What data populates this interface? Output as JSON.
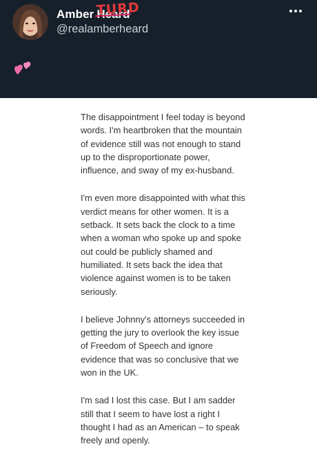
{
  "profile": {
    "display_name": "Amber",
    "struck_name": "Heard",
    "scribble": "TURD",
    "handle": "@realamberheard",
    "bio_icon": "two-hearts-emoji",
    "accent": "#e0245e"
  },
  "header": {
    "menu_icon": "more-dots-icon"
  },
  "statement": {
    "paragraphs": [
      "The disappointment I feel today is beyond words. I'm heartbroken that the mountain of evidence still was not enough to stand up to the disproportionate power, influence, and sway of my ex-husband.",
      "I'm even more disappointed with what this verdict means for other women. It is a setback. It sets back the clock to a time when a woman who spoke up and spoke out could be publicly shamed and humiliated. It sets back the idea that violence against women is to be taken seriously.",
      "I believe Johnny's attorneys succeeded in getting the jury to overlook the key issue of Freedom of Speech and ignore evidence that was so conclusive that we won in the UK.",
      "I'm sad I lost this case. But I am sadder still that I seem to have lost a right I thought I had as an American – to speak freely and openly."
    ]
  }
}
